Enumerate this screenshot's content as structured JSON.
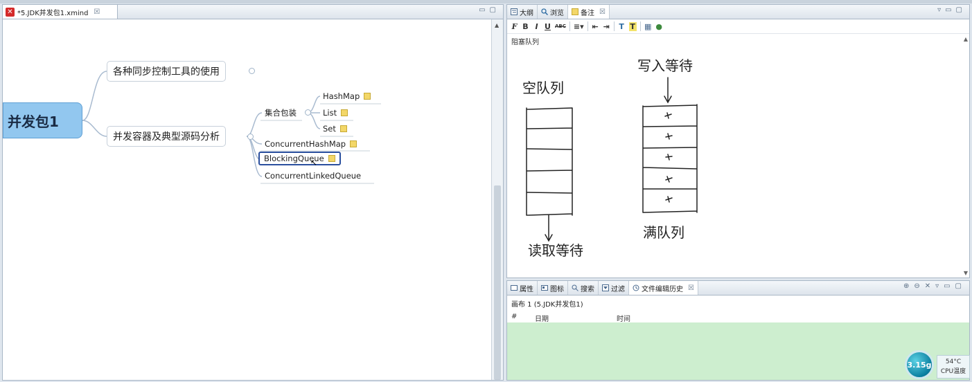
{
  "editor": {
    "tab_label": "*5.JDK并发包1.xmind",
    "tab_icon": "xmind-file-icon"
  },
  "mindmap": {
    "central": "并发包1",
    "topics": [
      {
        "label": "各种同步控制工具的使用"
      },
      {
        "label": "并发容器及典型源码分析"
      }
    ],
    "group": {
      "label": "集合包装",
      "children": [
        "HashMap",
        "List",
        "Set"
      ]
    },
    "leaves": [
      "ConcurrentHashMap",
      "BlockingQueue",
      "ConcurrentLinkedQueue"
    ],
    "selected": "BlockingQueue"
  },
  "notes_panel": {
    "tabs": [
      {
        "label": "大纲",
        "icon": "outline-icon"
      },
      {
        "label": "浏览",
        "icon": "magnifier-icon"
      },
      {
        "label": "备注",
        "icon": "note-icon",
        "active": true
      }
    ],
    "toolbar": [
      "F",
      "B",
      "I",
      "U",
      "ABC",
      "≡▾",
      "⇤",
      "⇥",
      "T",
      "T",
      "▦",
      "●"
    ],
    "note_title": "阻塞队列",
    "sketch": {
      "empty_queue": "空队列",
      "read_wait": "读取等待",
      "write_wait": "写入等待",
      "full_queue": "满队列"
    }
  },
  "history_panel": {
    "tabs": [
      {
        "label": "属性"
      },
      {
        "label": "图标"
      },
      {
        "label": "搜索"
      },
      {
        "label": "过滤"
      },
      {
        "label": "文件编辑历史",
        "active": true
      }
    ],
    "title": "画布 1 (5.JDK并发包1)",
    "columns": [
      "#",
      "日期",
      "时间"
    ]
  },
  "system": {
    "mem": "3.15g",
    "temp": "54°C",
    "temp_label": "CPU温度"
  },
  "colors": {
    "central_fill": "#92c7ef",
    "selection_border": "#2a4f9e",
    "history_bg": "#cdeecf"
  }
}
